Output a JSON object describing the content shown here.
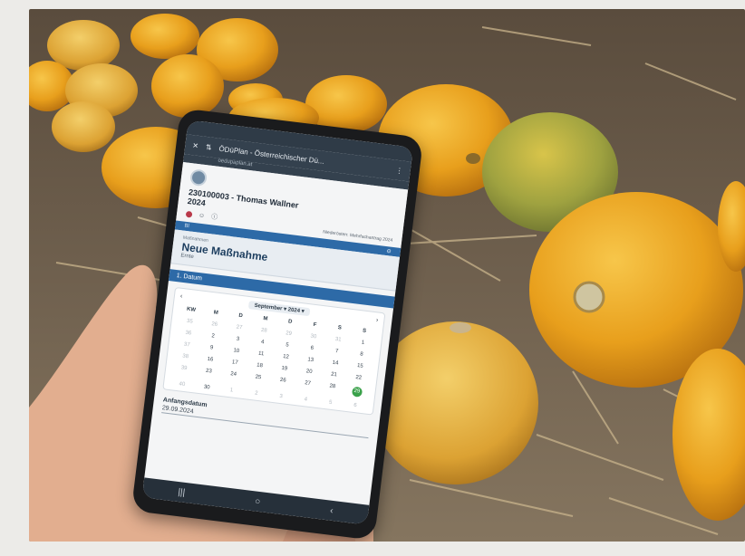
{
  "photo": {
    "subject": "hand holding smartphone in pumpkin field",
    "colors": {
      "soil": "#6a5a48",
      "pumpkin": "#e8a321",
      "pumpkin_green": "#9aa24a",
      "skin": "#e6b496"
    }
  },
  "phone": {
    "statusbar": {
      "time": "",
      "battery": ""
    },
    "appbar": {
      "close_icon": "close-icon",
      "title": "ÖDüPlan - Österreichischer Dü...",
      "url": "oedupaplan.at"
    },
    "farm": {
      "title": "230100003 - Thomas Wallner",
      "year": "2024",
      "link": "Niederösterr. Mehrfachantrag 2024"
    },
    "blue_bar": {
      "left": "Bl",
      "right": ""
    },
    "measure": {
      "crumb": "Maßnahmen",
      "heading": "Neue Maßnahme",
      "sub": "Ernte"
    },
    "section": {
      "label": "1. Datum"
    },
    "calendar": {
      "month": "September",
      "year": "2024",
      "weekdays": [
        "KW",
        "M",
        "D",
        "M",
        "D",
        "F",
        "S",
        "S"
      ],
      "rows": [
        [
          "35",
          "26",
          "27",
          "28",
          "29",
          "30",
          "31",
          "1"
        ],
        [
          "36",
          "2",
          "3",
          "4",
          "5",
          "6",
          "7",
          "8"
        ],
        [
          "37",
          "9",
          "10",
          "11",
          "12",
          "13",
          "14",
          "15"
        ],
        [
          "38",
          "16",
          "17",
          "18",
          "19",
          "20",
          "21",
          "22"
        ],
        [
          "39",
          "23",
          "24",
          "25",
          "26",
          "27",
          "28",
          "29"
        ],
        [
          "40",
          "30",
          "1",
          "2",
          "3",
          "4",
          "5",
          "6"
        ]
      ],
      "selected": "29"
    },
    "field": {
      "label": "Anfangsdatum",
      "value": "29.09.2024"
    }
  }
}
